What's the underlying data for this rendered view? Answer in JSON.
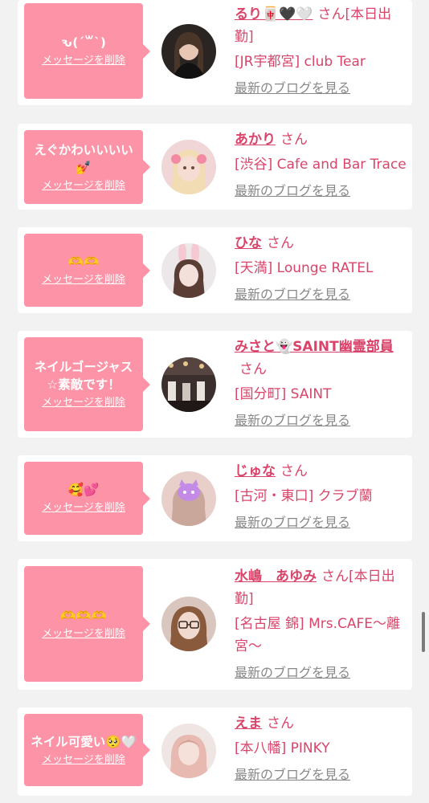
{
  "colors": {
    "bubble": "#fd93a6",
    "name": "#d9456a",
    "link_gray": "#888888",
    "card": "#ffffff",
    "background": "#f2f2f2"
  },
  "delete_label": "メッセージを削除",
  "blog_label": "最新のブログを見る",
  "items": [
    {
      "message": "ԅ(ˊ꒳ˋ)",
      "name": "るり🀄️🖤🤍",
      "san": "さん[本日出勤]",
      "shop": "[JR宇都宮] club Tear",
      "avatar": "dark-hair-selfie"
    },
    {
      "message": "えぐかわいいいい💅",
      "name": "あかり",
      "san": "さん",
      "shop": "[渋谷] Cafe and Bar Trace",
      "avatar": "blonde-pigtails"
    },
    {
      "message": "🫶🫶",
      "name": "ひな",
      "san": "さん",
      "shop": "[天満] Lounge RATEL",
      "avatar": "bunny-ears"
    },
    {
      "message": "ネイルゴージャス☆素敵です！",
      "name": "みさと👻SAINT幽霊部員",
      "san": "さん",
      "shop": "[国分町] SAINT",
      "avatar": "club-interior"
    },
    {
      "message": "🥰💕",
      "name": "じゅな",
      "san": "さん",
      "shop": "[古河・東口] クラブ蘭",
      "avatar": "cat-sticker"
    },
    {
      "message": "🫶🫶🫶",
      "name": "水嶋　あゆみ",
      "san": "さん[本日出勤]",
      "shop": "[名古屋 錦] Mrs.CAFE〜離宮〜",
      "avatar": "glasses"
    },
    {
      "message": "ネイル可愛い🥺🤍",
      "name": "えま",
      "san": "さん",
      "shop": "[本八幡] PINKY",
      "avatar": "pink-hair"
    }
  ]
}
